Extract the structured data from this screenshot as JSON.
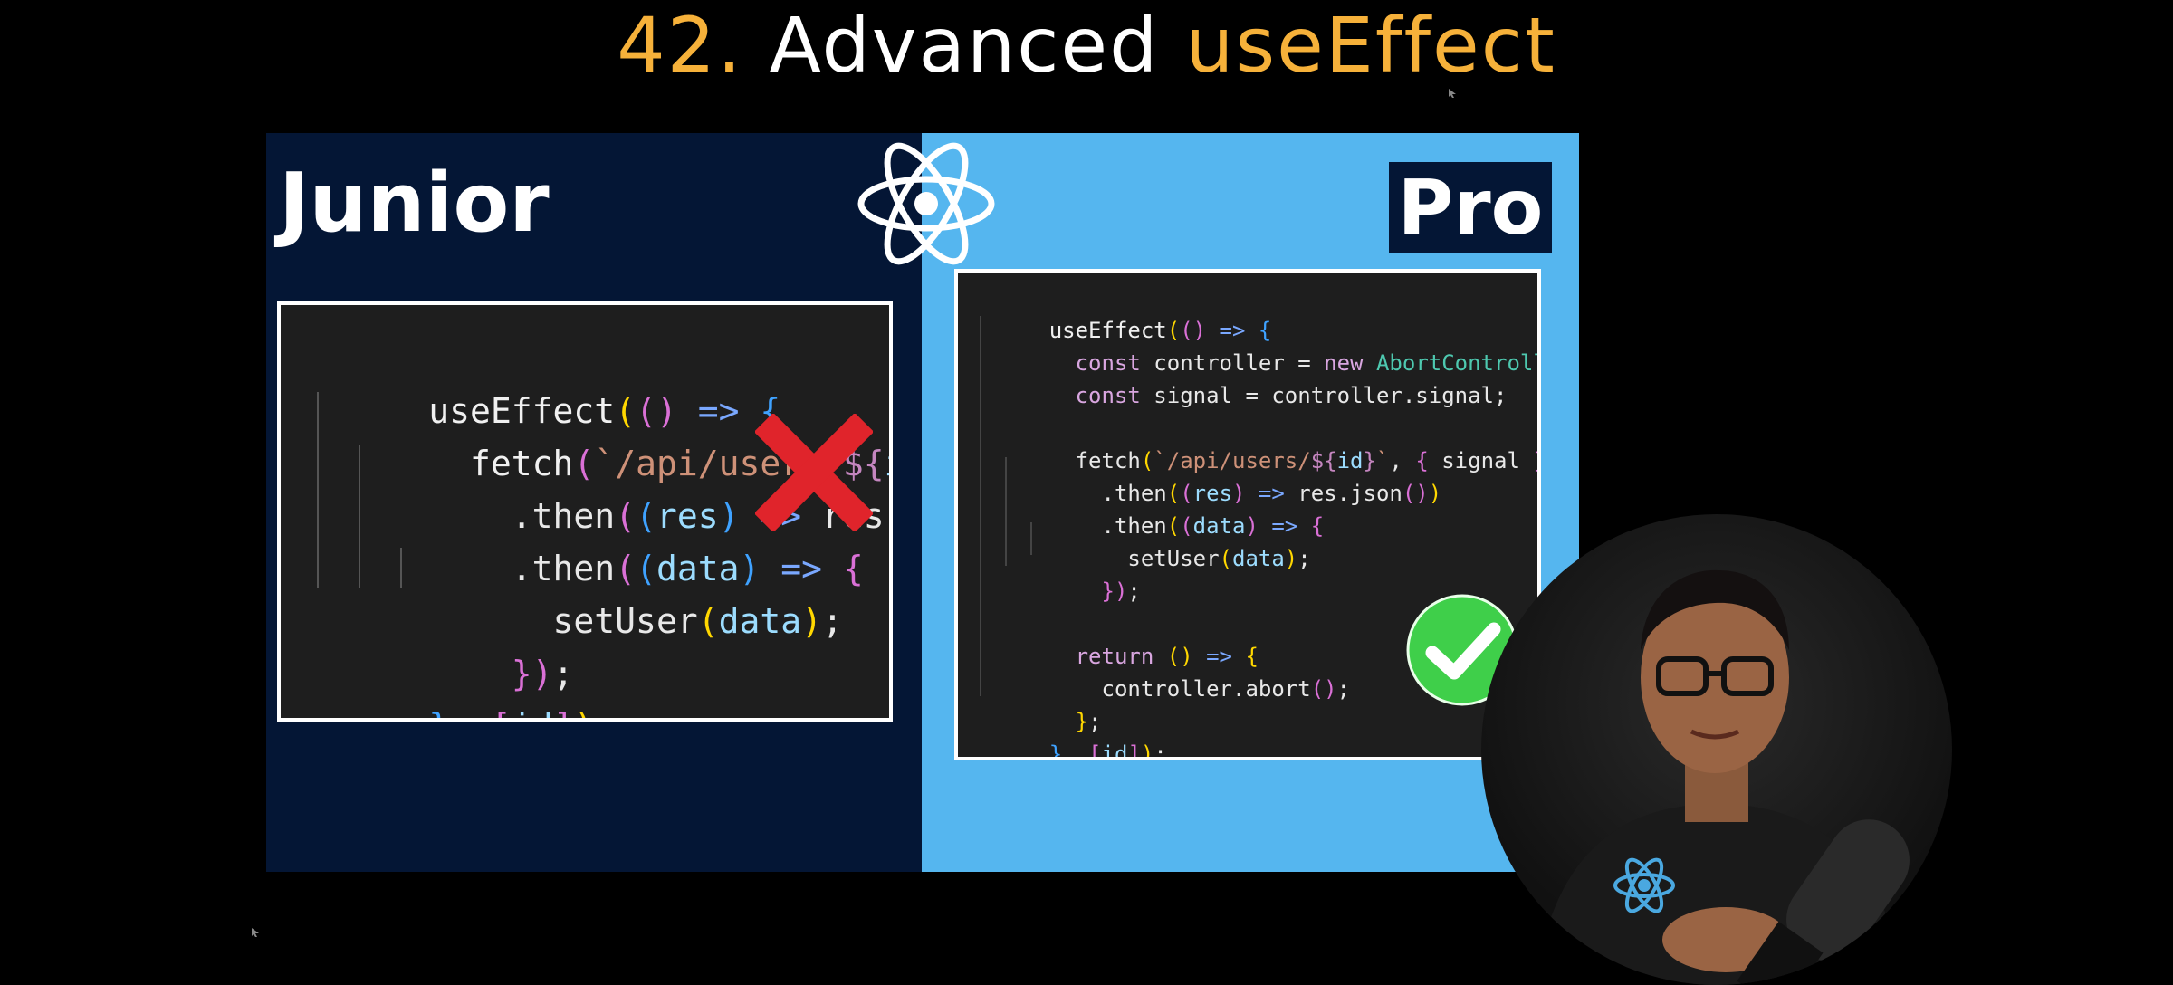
{
  "title": {
    "number": "42.",
    "word": "Advanced",
    "keyword": "useEffect"
  },
  "junior": {
    "label": "Junior",
    "code": [
      "useEffect(() => {",
      "  fetch(`/api/users/${id}`)",
      "    .then((res) => res.json(",
      "    .then((data) => {",
      "      setUser(data);",
      "    });",
      "}, [id]);"
    ]
  },
  "pro": {
    "label": "Pro",
    "code": [
      "useEffect(() => {",
      "  const controller = new AbortController();",
      "  const signal = controller.signal;",
      "",
      "  fetch(`/api/users/${id}`, { signal })",
      "    .then((res) => res.json())",
      "    .then((data) => {",
      "      setUser(data);",
      "    });",
      "",
      "  return () => {",
      "    controller.abort();",
      "  };",
      "}, [id]);"
    ]
  },
  "icons": {
    "wrong": "x-mark-icon",
    "right": "check-mark-icon",
    "logo": "react-logo-icon"
  },
  "colors": {
    "junior_bg": "#041635",
    "pro_bg": "#55b6ef",
    "title_accent": "#f6b13a",
    "wrong": "#e0242b",
    "right": "#3fcf4a"
  }
}
